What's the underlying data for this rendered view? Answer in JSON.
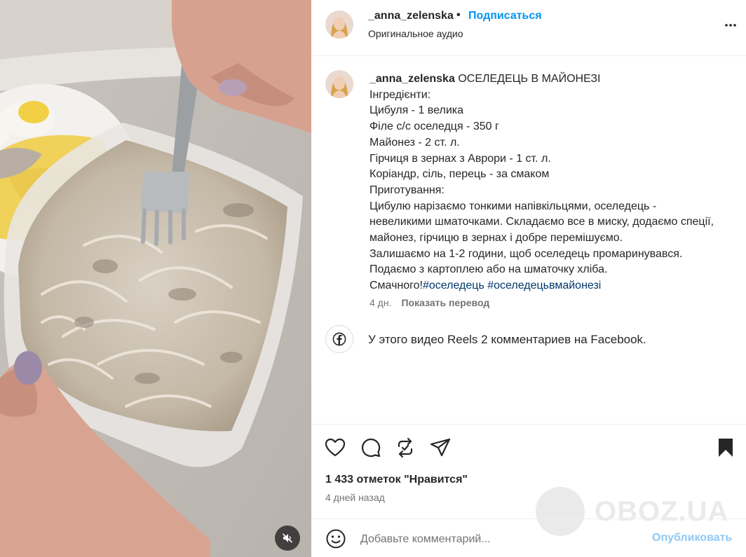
{
  "author": {
    "username": "_anna_zelenska",
    "follow_label": "Подписаться",
    "separator": "•",
    "audio_label": "Оригинальное аудио"
  },
  "caption": {
    "username": "_anna_zelenska",
    "title": "ОСЕЛЕДЕЦЬ В МАЙОНЕЗІ",
    "lines": [
      "Інгредієнти:",
      "Цибуля - 1 велика",
      "Філе с/с оселедця - 350 г",
      "Майонез - 2 ст. л.",
      "Гірчиця в зернах з Аврори - 1 ст. л.",
      "Коріандр, сіль, перець - за смаком",
      "Приготування:",
      "Цибулю нарізаємо тонкими напівкільцями, оселедець - невеликими шматочками. Складаємо все в миску, додаємо спеції, майонез, гірчицю в зернах і добре перемішуємо.",
      "Залишаємо на 1-2 години, щоб оселедець промаринувався.",
      "Подаємо з картоплею або на шматочку хліба."
    ],
    "last_line_prefix": "Смачного!",
    "hashtags": [
      "#оселедець",
      "#оселедецьвмайонезі"
    ],
    "age": "4 дн.",
    "translate_label": "Показать перевод"
  },
  "facebook_notice": "У этого видео Reels 2 комментариев на Facebook.",
  "likes_label": "1 433 отметок \"Нравится\"",
  "posted_ago": "4 дней назад",
  "comment": {
    "placeholder": "Добавьте комментарий...",
    "publish_label": "Опубликовать"
  },
  "watermark": "OBOZ.UA",
  "colors": {
    "link_blue": "#0095f6",
    "hashtag": "#00376b",
    "publish_disabled": "#8ec9f5",
    "secondary_text": "#737373"
  },
  "icons": [
    "more-icon",
    "facebook-icon",
    "heart-icon",
    "comment-icon",
    "repost-icon",
    "share-icon",
    "bookmark-icon",
    "emoji-icon",
    "mute-icon"
  ]
}
